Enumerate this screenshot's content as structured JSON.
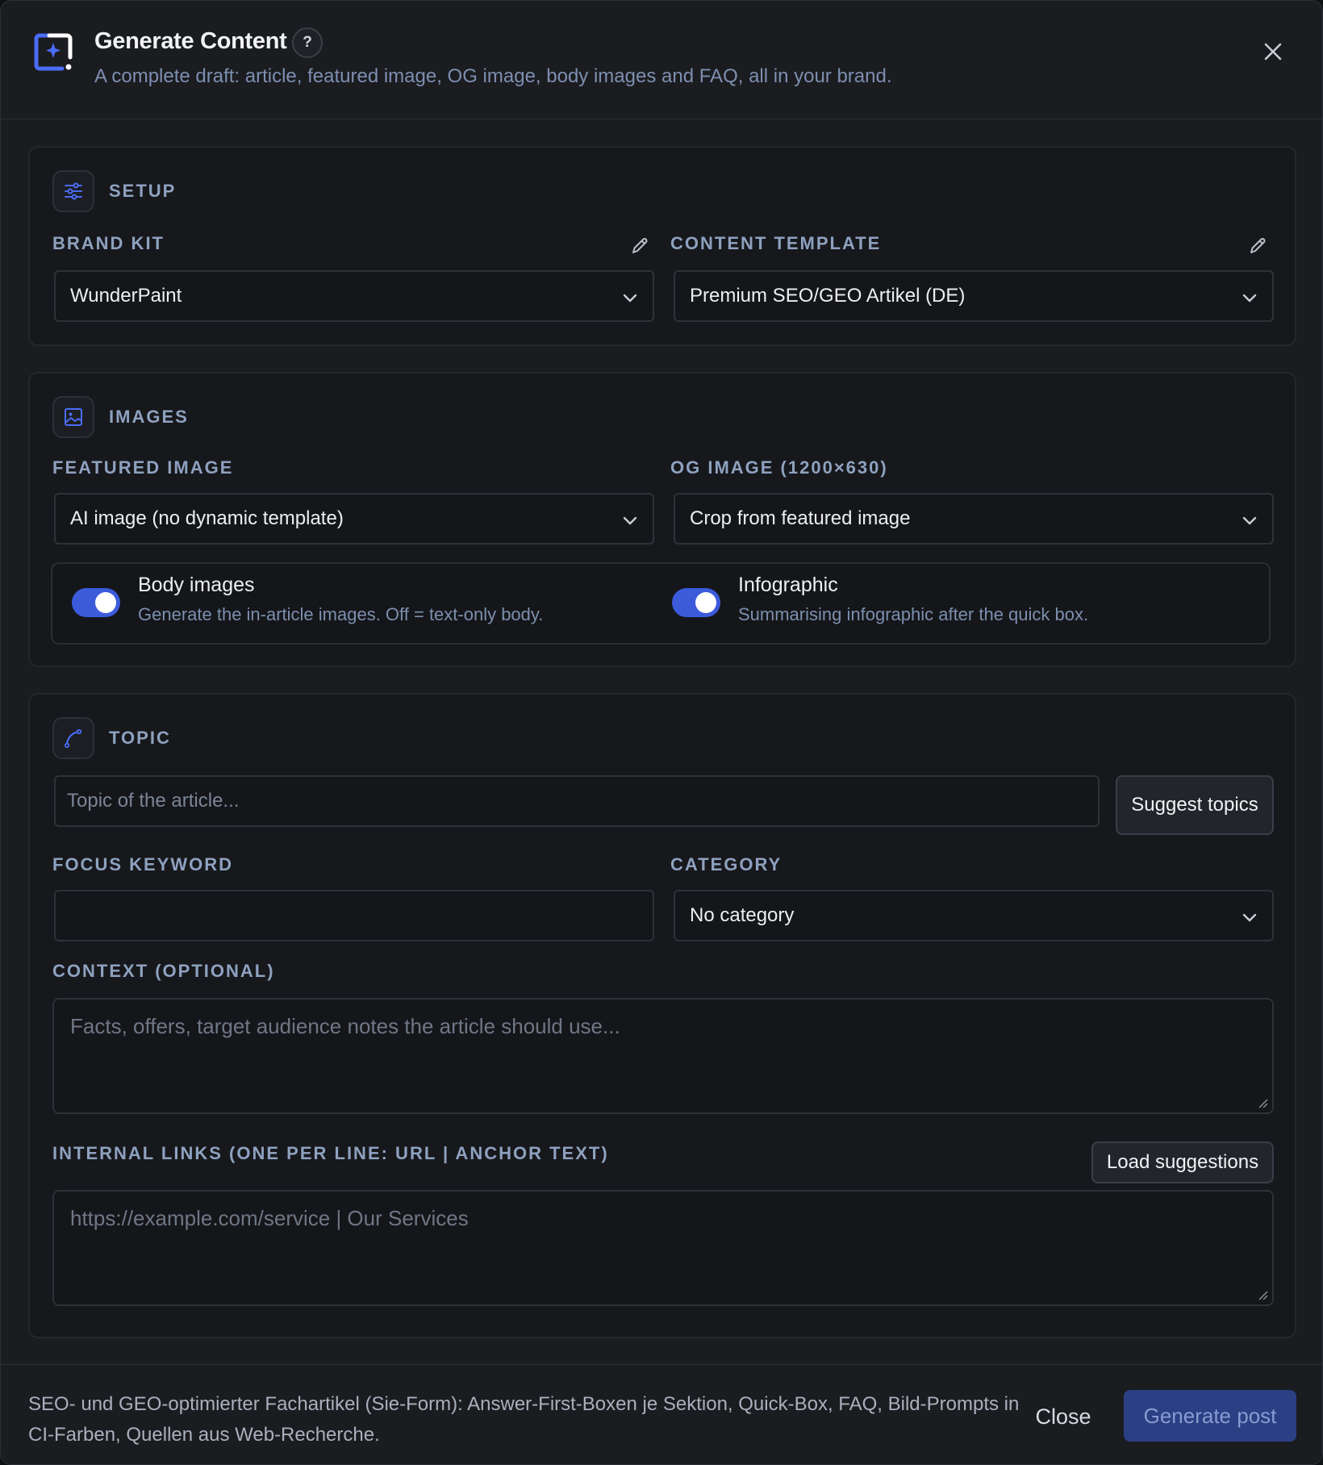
{
  "dialog": {
    "title": "Generate Content",
    "help": "?",
    "subtitle": "A complete draft: article, featured image, OG image, body images and FAQ, all in your brand."
  },
  "setup": {
    "section_title": "SETUP",
    "brand_kit_label": "BRAND KIT",
    "brand_kit_value": "WunderPaint",
    "content_template_label": "CONTENT TEMPLATE",
    "content_template_value": "Premium SEO/GEO Artikel (DE)"
  },
  "images": {
    "section_title": "IMAGES",
    "featured_label": "FEATURED IMAGE",
    "featured_value": "AI image (no dynamic template)",
    "og_label": "OG IMAGE (1200×630)",
    "og_value": "Crop from featured image",
    "body_images": {
      "title": "Body images",
      "desc": "Generate the in-article images. Off = text-only body.",
      "enabled": true
    },
    "infographic": {
      "title": "Infographic",
      "desc": "Summarising infographic after the quick box.",
      "enabled": true
    }
  },
  "topic": {
    "section_title": "TOPIC",
    "topic_placeholder": "Topic of the article...",
    "suggest_button": "Suggest topics",
    "focus_keyword_label": "FOCUS KEYWORD",
    "focus_keyword_value": "",
    "category_label": "CATEGORY",
    "category_value": "No category",
    "context_label": "CONTEXT (OPTIONAL)",
    "context_placeholder": "Facts, offers, target audience notes the article should use...",
    "internal_links_label": "INTERNAL LINKS (ONE PER LINE: URL | ANCHOR TEXT)",
    "load_suggestions_button": "Load suggestions",
    "internal_links_placeholder": "https://example.com/service | Our Services"
  },
  "footer": {
    "description": "SEO- und GEO-optimierter Fachartikel (Sie-Form): Answer-First-Boxen je Sektion, Quick-Box, FAQ, Bild-Prompts in CI-Farben, Quellen aus Web-Recherche.",
    "close_button": "Close",
    "generate_button": "Generate post"
  },
  "colors": {
    "accent": "#3b5bdb",
    "primary_disabled": "#2b3f85",
    "label": "#8ea1bf"
  }
}
